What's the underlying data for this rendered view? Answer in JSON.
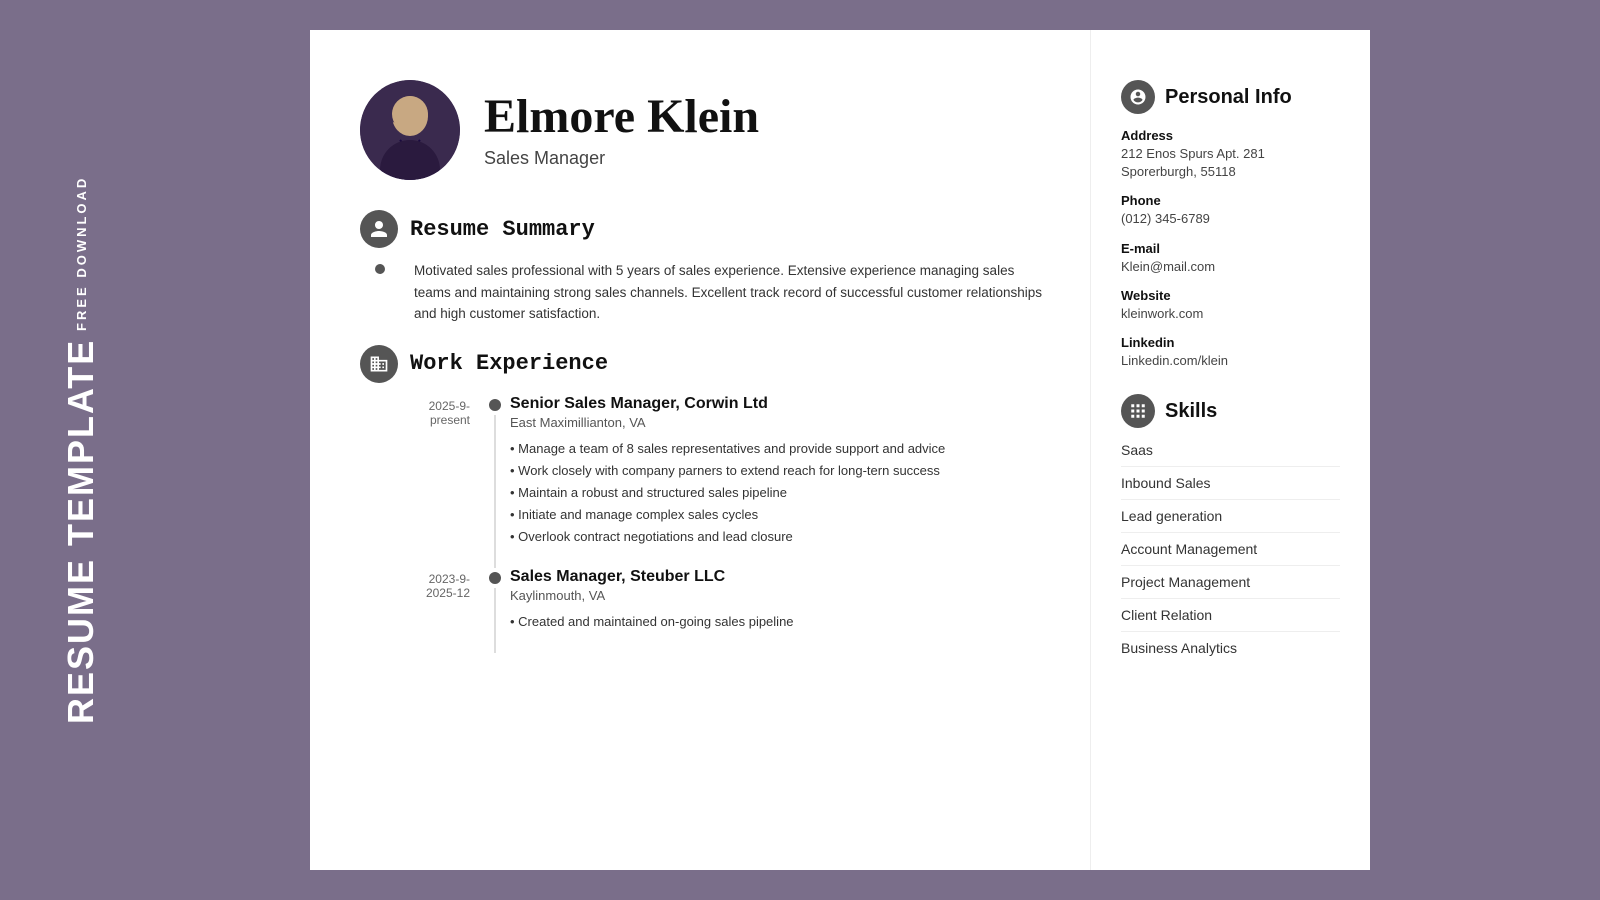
{
  "sidebar_label": {
    "free_download": "FREE DOWNLOAD",
    "resume_template": "RESUME TEMPLATE"
  },
  "header": {
    "name": "Elmore Klein",
    "job_title": "Sales Manager"
  },
  "sections": {
    "summary": {
      "title": "Resume Summary",
      "text": "Motivated sales professional with 5 years of sales experience. Extensive experience managing sales teams and maintaining strong sales channels. Excellent track record of successful customer relationships and high customer satisfaction."
    },
    "work_experience": {
      "title": "Work Experience",
      "jobs": [
        {
          "title": "Senior Sales Manager, Corwin Ltd",
          "location": "East Maximillianton, VA",
          "date": "2025-9-\npresent",
          "bullets": [
            "Manage a team of 8 sales representatives and provide support and advice",
            "Work closely with company parners to extend reach for long-tern success",
            "Maintain a robust and structured sales pipeline",
            "Initiate and manage complex sales cycles",
            "Overlook contract negotiations and lead closure"
          ]
        },
        {
          "title": "Sales Manager, Steuber LLC",
          "location": "Kaylinmouth, VA",
          "date": "2023-9-\n2025-12",
          "bullets": [
            "Created and maintained on-going sales pipeline"
          ]
        }
      ]
    }
  },
  "personal_info": {
    "section_title": "Personal Info",
    "address_label": "Address",
    "address_line1": "212 Enos Spurs Apt. 281",
    "address_line2": "Sporerburgh, 55118",
    "phone_label": "Phone",
    "phone_value": "(012) 345-6789",
    "email_label": "E-mail",
    "email_value": "Klein@mail.com",
    "website_label": "Website",
    "website_value": "kleinwork.com",
    "linkedin_label": "Linkedin",
    "linkedin_value": "Linkedin.com/klein"
  },
  "skills": {
    "section_title": "Skills",
    "items": [
      "Saas",
      "Inbound Sales",
      "Lead generation",
      "Account Management",
      "Project Management",
      "Client Relation",
      "Business Analytics"
    ]
  }
}
